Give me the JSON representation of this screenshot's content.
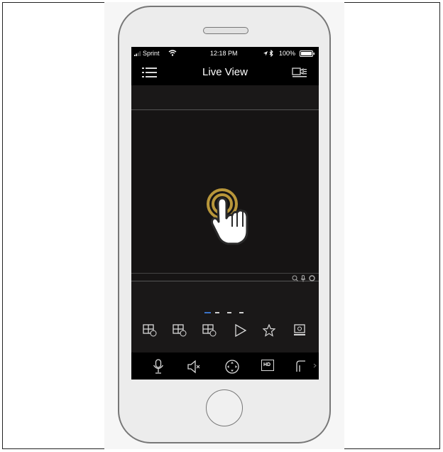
{
  "status_bar": {
    "carrier": "Sprint",
    "time": "12:18 PM",
    "battery": "100%"
  },
  "nav": {
    "title": "Live View",
    "menu_icon": "list-menu-icon",
    "device_icon": "camera-list-icon"
  },
  "page_indicator": {
    "pages": 4,
    "active_page": 1
  },
  "layout_toolbar": {
    "items": [
      {
        "name": "4-split",
        "badge": "4"
      },
      {
        "name": "9-split",
        "badge": "9"
      },
      {
        "name": "16-split",
        "badge": "16"
      },
      {
        "name": "play",
        "badge": ""
      },
      {
        "name": "favorite",
        "badge": ""
      },
      {
        "name": "playback",
        "badge": ""
      }
    ]
  },
  "control_bar": {
    "items": [
      {
        "name": "microphone",
        "label": ""
      },
      {
        "name": "mute",
        "label": ""
      },
      {
        "name": "ptz",
        "label": ""
      },
      {
        "name": "hd",
        "label": "HD"
      },
      {
        "name": "snapshot",
        "label": ""
      }
    ]
  },
  "colors": {
    "accent": "#b8963a",
    "screen_bg": "#1a1818",
    "bar_bg": "#000000",
    "indicator_active": "#3b73c8"
  }
}
